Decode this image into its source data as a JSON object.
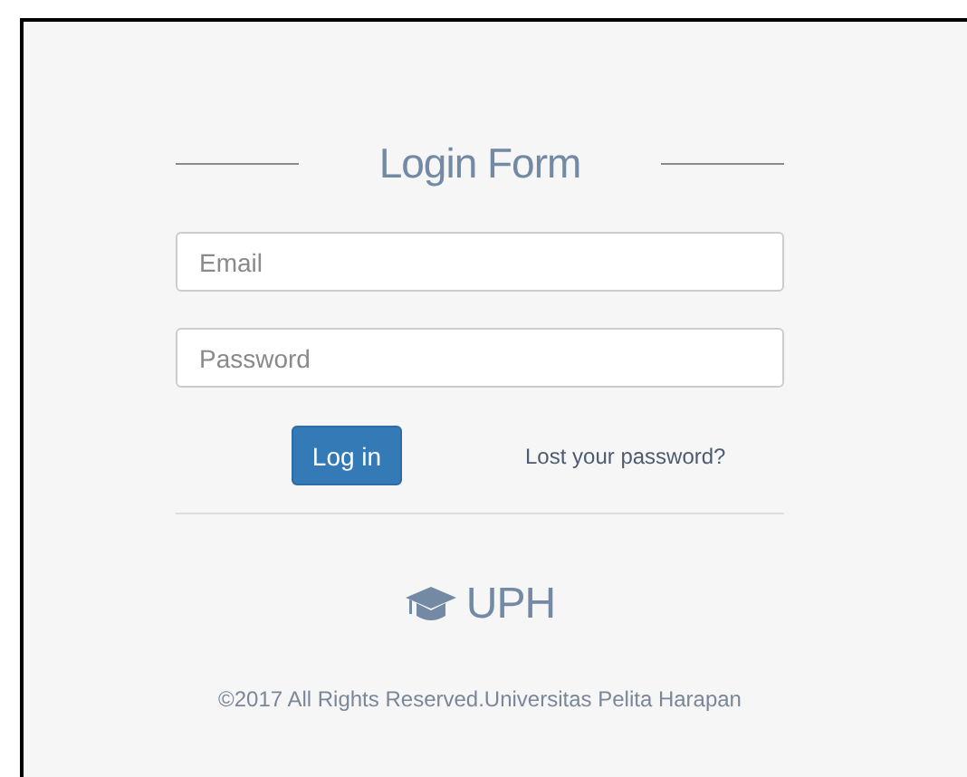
{
  "title": "Login Form",
  "fields": [
    {
      "placeholder": "Email"
    },
    {
      "placeholder": "Password"
    }
  ],
  "login_button": "Log in",
  "lost_password_link": "Lost your password?",
  "logo": {
    "text": "UPH"
  },
  "footer": "©2017 All Rights Reserved.Universitas Pelita Harapan"
}
